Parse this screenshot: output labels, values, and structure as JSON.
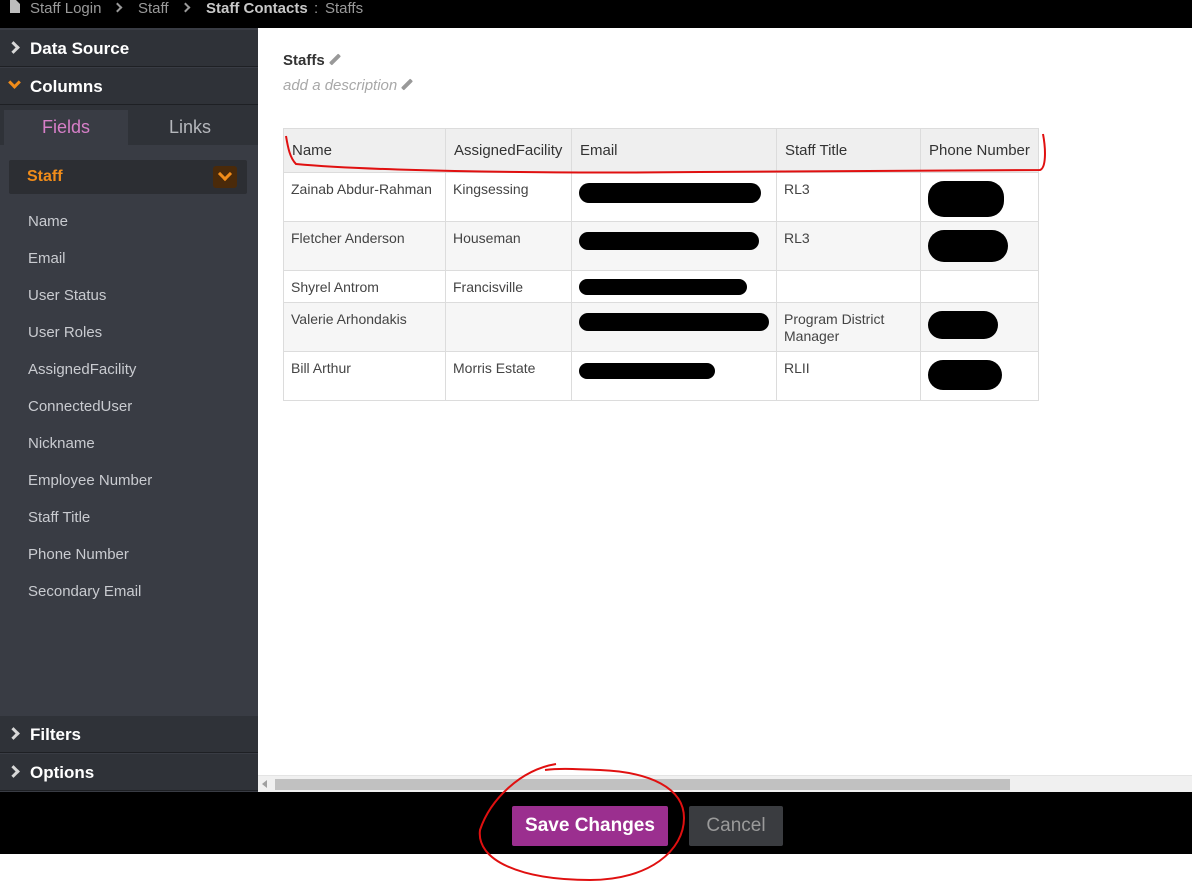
{
  "breadcrumb": {
    "items": [
      "Staff Login",
      "Staff",
      "Staff Contacts"
    ],
    "separator_text": ":",
    "view": "Staffs"
  },
  "sidebar": {
    "sections": {
      "data_source": "Data Source",
      "columns": "Columns",
      "filters": "Filters",
      "options": "Options"
    },
    "tabs": {
      "fields": "Fields",
      "links": "Links"
    },
    "object_select": "Staff",
    "fields": [
      "Name",
      "Email",
      "User Status",
      "User Roles",
      "AssignedFacility",
      "ConnectedUser",
      "Nickname",
      "Employee Number",
      "Staff Title",
      "Phone Number",
      "Secondary Email"
    ]
  },
  "main": {
    "title": "Staffs",
    "description_placeholder": "add a description",
    "table": {
      "columns": [
        "Name",
        "AssignedFacility",
        "Email",
        "Staff Title",
        "Phone Number"
      ],
      "rows": [
        {
          "name": "Zainab Abdur-Rahman",
          "facility": "Kingsessing",
          "email": "[redacted]",
          "title": "RL3",
          "phone": "[redacted]"
        },
        {
          "name": "Fletcher Anderson",
          "facility": "Houseman",
          "email": "[redacted]",
          "title": "RL3",
          "phone": "[redacted]"
        },
        {
          "name": "Shyrel Antrom",
          "facility": "Francisville",
          "email": "[redacted]",
          "title": "",
          "phone": ""
        },
        {
          "name": "Valerie Arhondakis",
          "facility": "",
          "email": "[redacted]",
          "title": "Program District Manager",
          "phone": "[redacted]"
        },
        {
          "name": "Bill Arthur",
          "facility": "Morris Estate",
          "email": "[redacted]",
          "title": "RLII",
          "phone": "[redacted]"
        }
      ]
    }
  },
  "footer": {
    "save": "Save Changes",
    "cancel": "Cancel"
  },
  "colors": {
    "accent": "#9b2f8f",
    "orange": "#f08c1a",
    "fields_tab": "#d77fc8",
    "annotation": "#e01010"
  }
}
